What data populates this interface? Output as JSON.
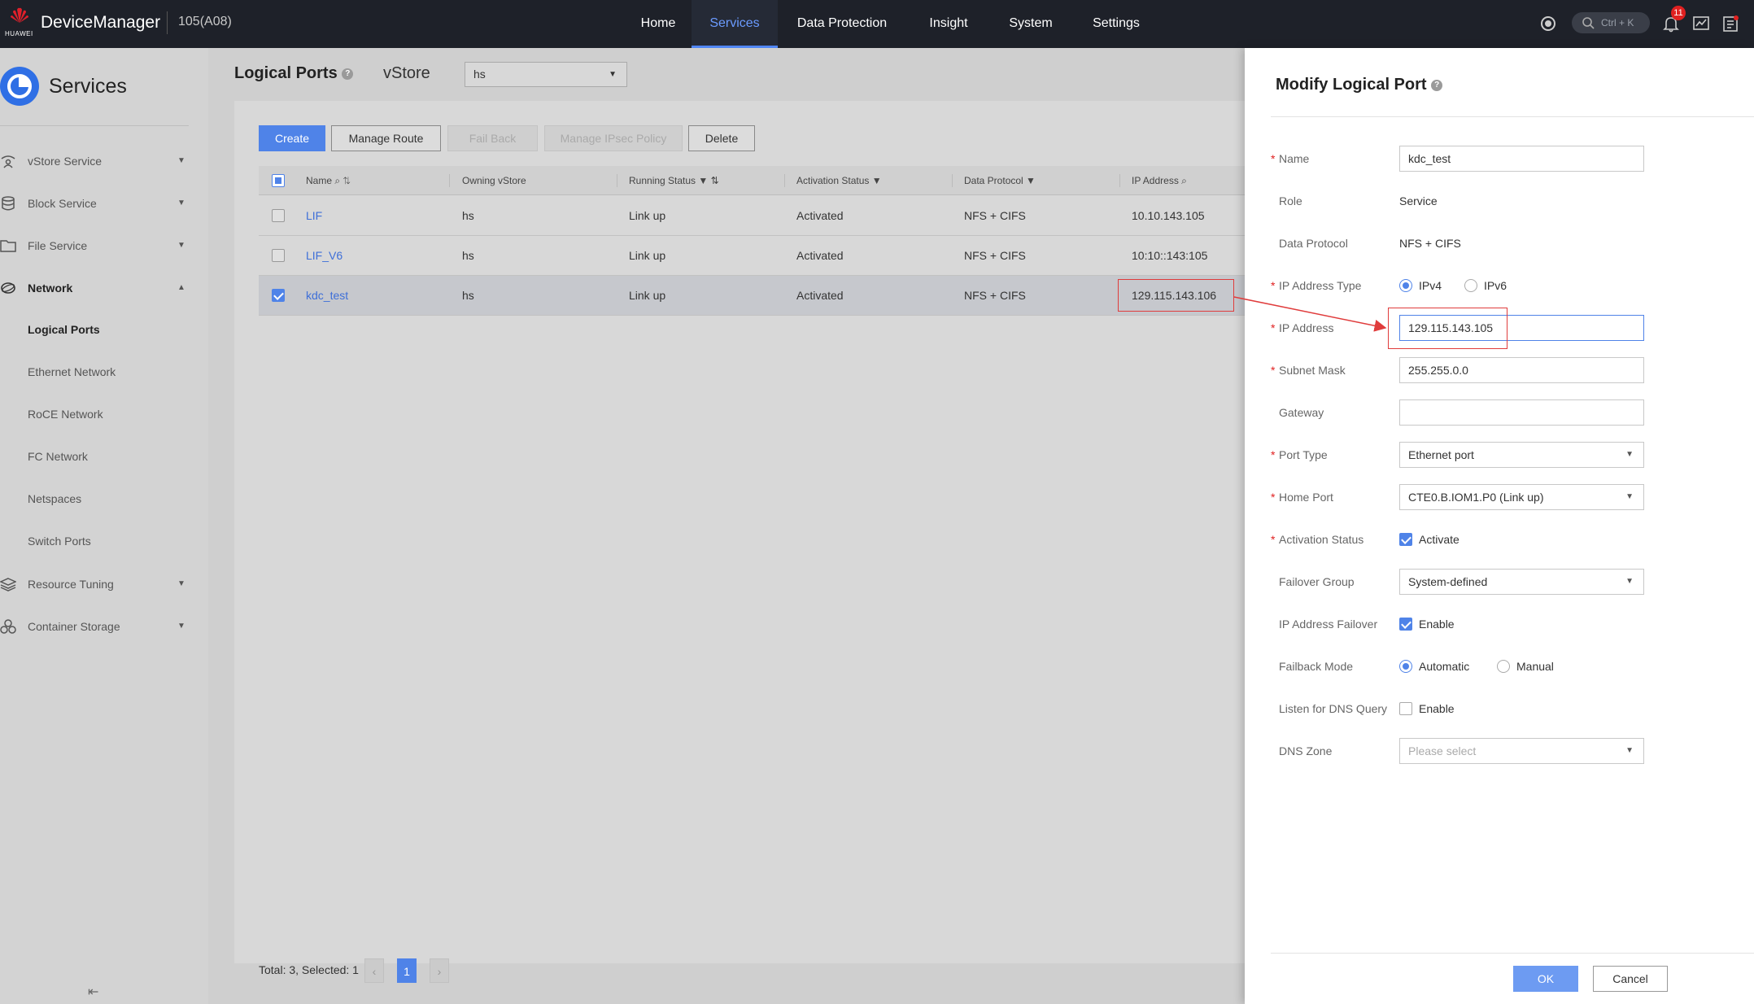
{
  "brand": {
    "logo_text": "HUAWEI",
    "app_name": "DeviceManager",
    "device_id": "105(A08)"
  },
  "nav": {
    "items": [
      "Home",
      "Services",
      "Data Protection",
      "Insight",
      "System",
      "Settings"
    ],
    "active": "Services"
  },
  "topbar": {
    "search_hint": "Ctrl + K",
    "notification_count": "11"
  },
  "sidebar": {
    "title": "Services",
    "items": [
      {
        "label": "vStore Service",
        "icon": "vstore-icon"
      },
      {
        "label": "Block Service",
        "icon": "database-icon"
      },
      {
        "label": "File Service",
        "icon": "folder-icon"
      },
      {
        "label": "Network",
        "icon": "globe-icon"
      }
    ],
    "network_children": [
      "Logical Ports",
      "Ethernet Network",
      "RoCE Network",
      "FC Network",
      "Netspaces",
      "Switch Ports"
    ],
    "bottom_items": [
      {
        "label": "Resource Tuning",
        "icon": "layers-icon"
      },
      {
        "label": "Container Storage",
        "icon": "cluster-icon"
      }
    ],
    "collapse_icon": "collapse-icon"
  },
  "main": {
    "title": "Logical Ports",
    "vstore_label": "vStore",
    "vstore_value": "hs",
    "buttons": {
      "create": "Create",
      "manage_route": "Manage Route",
      "fail_back": "Fail Back",
      "manage_ipsec": "Manage IPsec Policy",
      "delete": "Delete"
    },
    "columns": [
      "Name",
      "Owning vStore",
      "Running Status",
      "Activation Status",
      "Data Protocol",
      "IP Address"
    ],
    "rows": [
      {
        "name": "LIF",
        "vstore": "hs",
        "running": "Link up",
        "activation": "Activated",
        "protocol": "NFS + CIFS",
        "ip": "10.10.143.105"
      },
      {
        "name": "LIF_V6",
        "vstore": "hs",
        "running": "Link up",
        "activation": "Activated",
        "protocol": "NFS + CIFS",
        "ip": "10:10::143:105"
      },
      {
        "name": "kdc_test",
        "vstore": "hs",
        "running": "Link up",
        "activation": "Activated",
        "protocol": "NFS + CIFS",
        "ip": "129.115.143.106"
      }
    ],
    "pager": {
      "total": "Total: 3, Selected: 1",
      "prev": "‹",
      "page": "1",
      "next": "›"
    }
  },
  "drawer": {
    "title": "Modify Logical Port",
    "fields": {
      "name": {
        "label": "Name",
        "value": "kdc_test"
      },
      "role": {
        "label": "Role",
        "value": "Service"
      },
      "data_protocol": {
        "label": "Data Protocol",
        "value": "NFS + CIFS"
      },
      "ip_type": {
        "label": "IP Address Type",
        "opt1": "IPv4",
        "opt2": "IPv6"
      },
      "ip": {
        "label": "IP Address",
        "value": "129.115.143.105"
      },
      "subnet": {
        "label": "Subnet Mask",
        "value": "255.255.0.0"
      },
      "gateway": {
        "label": "Gateway",
        "value": ""
      },
      "port_type": {
        "label": "Port Type",
        "value": "Ethernet port"
      },
      "home_port": {
        "label": "Home Port",
        "value": "CTE0.B.IOM1.P0 (Link up)"
      },
      "activation": {
        "label": "Activation Status",
        "value": "Activate"
      },
      "failover_group": {
        "label": "Failover Group",
        "value": "System-defined"
      },
      "ip_failover": {
        "label": "IP Address Failover",
        "value": "Enable"
      },
      "failback_mode": {
        "label": "Failback Mode",
        "opt1": "Automatic",
        "opt2": "Manual"
      },
      "dns_listen": {
        "label": "Listen for DNS Query",
        "value": "Enable"
      },
      "dns_zone": {
        "label": "DNS Zone",
        "placeholder": "Please select"
      }
    },
    "ok": "OK",
    "cancel": "Cancel"
  },
  "colors": {
    "accent": "#4f83e8",
    "topbar": "#1e2129",
    "annotation": "#e03c3c"
  }
}
